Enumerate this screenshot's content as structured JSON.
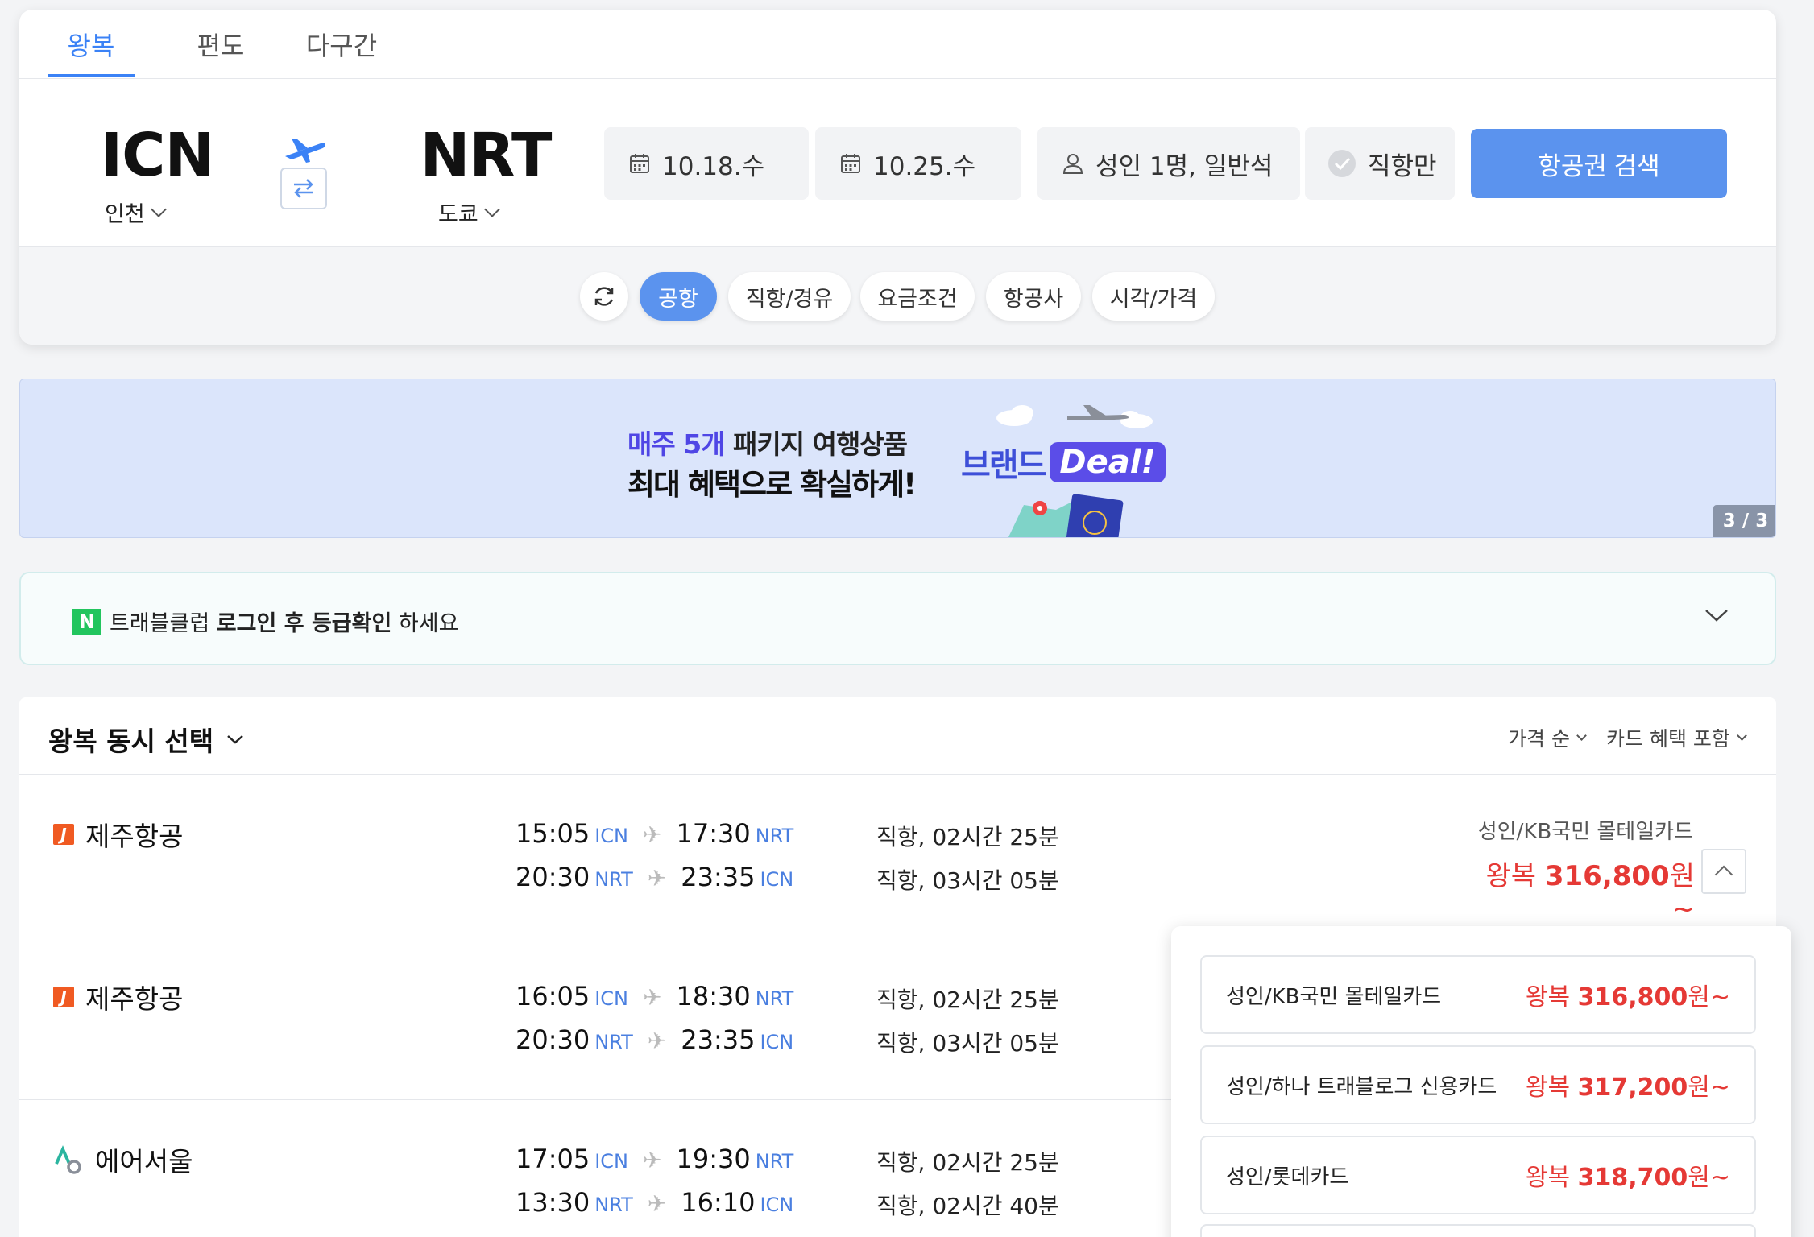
{
  "tabs": [
    "왕복",
    "편도",
    "다구간"
  ],
  "route": {
    "origin_code": "ICN",
    "origin_city": "인천",
    "dest_code": "NRT",
    "dest_city": "도쿄"
  },
  "search": {
    "depart_date": "10.18.수",
    "return_date": "10.25.수",
    "passengers": "성인 1명, 일반석",
    "direct_only": "직항만",
    "search_button": "항공권 검색"
  },
  "filters": [
    "공항",
    "직항/경유",
    "요금조건",
    "항공사",
    "시각/가격"
  ],
  "banner": {
    "line1_highlight": "매주 5개",
    "line1_rest": " 패키지 여행상품",
    "line2": "최대 혜택으로 확실하게!",
    "brand": "브랜드",
    "deal": "Deal!",
    "page": "3 / 3"
  },
  "login": {
    "badge": "N",
    "prefix": "트래블클럽 ",
    "bold": "로그인 후 등급확인",
    "suffix": " 하세요"
  },
  "results": {
    "title": "왕복 동시 선택",
    "sort_price": "가격 순",
    "sort_card": "카드 혜택 포함",
    "flights": [
      {
        "airline": "제주항공",
        "out_dep": "15:05",
        "out_dep_code": "ICN",
        "out_arr": "17:30",
        "out_arr_code": "NRT",
        "out_dur": "직항, 02시간 25분",
        "ret_dep": "20:30",
        "ret_dep_code": "NRT",
        "ret_arr": "23:35",
        "ret_arr_code": "ICN",
        "ret_dur": "직항, 03시간 05분",
        "card": "성인/KB국민 몰테일카드",
        "price_prefix": "왕복 ",
        "price": "316,800",
        "price_suffix": "원~"
      },
      {
        "airline": "제주항공",
        "out_dep": "16:05",
        "out_dep_code": "ICN",
        "out_arr": "18:30",
        "out_arr_code": "NRT",
        "out_dur": "직항, 02시간 25분",
        "ret_dep": "20:30",
        "ret_dep_code": "NRT",
        "ret_arr": "23:35",
        "ret_arr_code": "ICN",
        "ret_dur": "직항, 03시간 05분"
      },
      {
        "airline": "에어서울",
        "out_dep": "17:05",
        "out_dep_code": "ICN",
        "out_arr": "19:30",
        "out_arr_code": "NRT",
        "out_dur": "직항, 02시간 25분",
        "ret_dep": "13:30",
        "ret_dep_code": "NRT",
        "ret_arr": "16:10",
        "ret_arr_code": "ICN",
        "ret_dur": "직항, 02시간 40분"
      }
    ]
  },
  "card_options": [
    {
      "label": "성인/KB국민 몰테일카드",
      "prefix": "왕복 ",
      "price": "316,800",
      "suffix": "원~"
    },
    {
      "label": "성인/하나 트래블로그 신용카드",
      "prefix": "왕복 ",
      "price": "317,200",
      "suffix": "원~"
    },
    {
      "label": "성인/롯데카드",
      "prefix": "왕복 ",
      "price": "318,700",
      "suffix": "원~"
    }
  ],
  "colors": {
    "accent": "#3b82f6",
    "button": "#5b93ee",
    "price": "#e53935",
    "banner_bg": "#dbe5fb"
  }
}
